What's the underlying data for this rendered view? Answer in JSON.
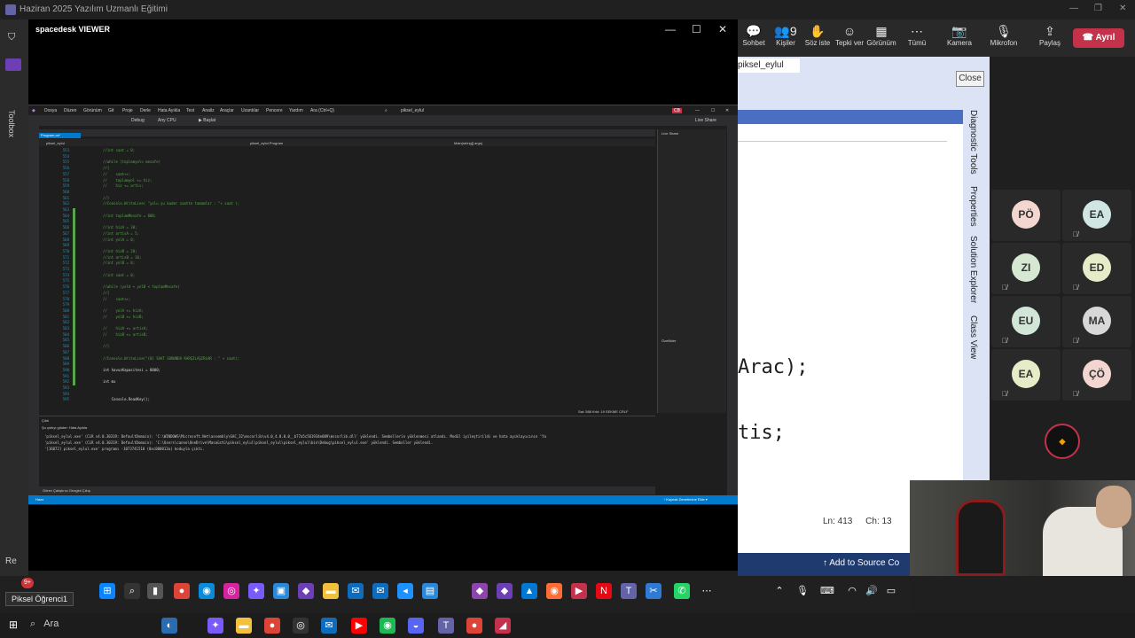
{
  "teams": {
    "window_title": "Haziran 2025 Yazılım Uzmanlı Eğitimi",
    "toolbar": [
      {
        "icon": "chat-icon",
        "label": "Sohbet",
        "glyph": "💬"
      },
      {
        "icon": "people-icon",
        "label": "Kişiler",
        "glyph": "👥",
        "badge": "9"
      },
      {
        "icon": "raise-hand-icon",
        "label": "Söz iste",
        "glyph": "✋"
      },
      {
        "icon": "reaction-icon",
        "label": "Tepki ver",
        "glyph": "☺"
      },
      {
        "icon": "view-icon",
        "label": "Görünüm",
        "glyph": "▦"
      },
      {
        "icon": "more-icon",
        "label": "Tümü",
        "glyph": "⋯"
      },
      {
        "icon": "camera-off-icon",
        "label": "Kamera",
        "glyph": "📷"
      },
      {
        "icon": "mic-off-icon",
        "label": "Mikrofon",
        "glyph": "🎙"
      },
      {
        "icon": "share-icon",
        "label": "Paylaş",
        "glyph": "⇪"
      }
    ],
    "leave_label": "Ayrıl",
    "close_tooltip": "Close"
  },
  "spacedesk": {
    "title": "spacedesk VIEWER"
  },
  "vs_inner": {
    "menu": [
      "Dosya",
      "Düzen",
      "Görünüm",
      "Git",
      "Proje",
      "Derle",
      "Hata Ayıkla",
      "Test",
      "Analiz",
      "Araçlar",
      "Uzantılar",
      "Pencere",
      "Yardım",
      "Ara (Ctrl+Q)"
    ],
    "solution": "piksel_eylul",
    "toolbar_debug": "Debug",
    "toolbar_cpu": "Any CPU",
    "toolbar_start": "▶ Başlat",
    "live_share": "Live Share",
    "tab": "Program.cs*",
    "nav_project": "piksel_eylul",
    "nav_class": "piksel_eylul.Program",
    "nav_method": "Main(string[] args)",
    "code_lines": [
      {
        "n": "553",
        "t": "//int saat = 0;"
      },
      {
        "n": "554",
        "t": ""
      },
      {
        "n": "555",
        "t": "//while (toplamyol< mesafe)"
      },
      {
        "n": "556",
        "t": "//{"
      },
      {
        "n": "557",
        "t": "//    saat++;"
      },
      {
        "n": "558",
        "t": "//    toplamyol += hiz;"
      },
      {
        "n": "559",
        "t": "//    hiz += artis;"
      },
      {
        "n": "560",
        "t": ""
      },
      {
        "n": "561",
        "t": "//}"
      },
      {
        "n": "562",
        "t": "//Console.WriteLine( \"yolu şu kader saatte tamamlar : \"+ saat );"
      },
      {
        "n": "563",
        "t": ""
      },
      {
        "n": "564",
        "t": "//int toplamMesafe = 600;"
      },
      {
        "n": "565",
        "t": ""
      },
      {
        "n": "566",
        "t": "//int hizA = 30;"
      },
      {
        "n": "567",
        "t": "//int artisA = 5;"
      },
      {
        "n": "568",
        "t": "//int yolA = 0;"
      },
      {
        "n": "569",
        "t": ""
      },
      {
        "n": "570",
        "t": "//int hizB = 20;"
      },
      {
        "n": "571",
        "t": "//int artisB = 10;"
      },
      {
        "n": "572",
        "t": "//int yolB = 0;"
      },
      {
        "n": "573",
        "t": ""
      },
      {
        "n": "574",
        "t": "//int saat = 0;"
      },
      {
        "n": "575",
        "t": ""
      },
      {
        "n": "576",
        "t": "//while (yolA + yolB < toplamMesafe)"
      },
      {
        "n": "577",
        "t": "//{"
      },
      {
        "n": "578",
        "t": "//    saat++;"
      },
      {
        "n": "579",
        "t": ""
      },
      {
        "n": "580",
        "t": "//    yolA += hizA;"
      },
      {
        "n": "581",
        "t": "//    yolB += hizB;"
      },
      {
        "n": "582",
        "t": ""
      },
      {
        "n": "583",
        "t": "//    hizA += artisA;"
      },
      {
        "n": "584",
        "t": "//    hizB += artisB;"
      },
      {
        "n": "585",
        "t": ""
      },
      {
        "n": "586",
        "t": "//}"
      },
      {
        "n": "587",
        "t": ""
      },
      {
        "n": "588",
        "t": "//Console.WriteLine(\"{0} SAAT SONUNDA KARŞILAŞIRLAR : \" + saat);"
      },
      {
        "n": "589",
        "t": ""
      },
      {
        "n": "590",
        "t": "int havuzKapasitesi = 8000;"
      },
      {
        "n": "591",
        "t": ""
      },
      {
        "n": "592",
        "t": "int mu"
      },
      {
        "n": "593",
        "t": ""
      },
      {
        "n": "594",
        "t": ""
      },
      {
        "n": "595",
        "t": "    Console.ReadKey();"
      }
    ],
    "position": "Sat: 588   Krkt: 19   SEKME   CRLF",
    "output_title": "Çıktı",
    "output_from": "Şu çıktıyı göster:  Hata Ayıkla",
    "output_lines": [
      "'piksel_eylul.exe' (CLR v4.0.30319: DefaultDomain): 'C:\\WINDOWS\\Microsoft.Net\\assembly\\GAC_32\\mscorlib\\v4.0_4.0.0.0__b77a5c561934e089\\mscorlib.dll' yüklendi. Sembollerin yüklenmesi atlandı. Modül iyileştirildi ve hata ayıklayıcının 'Ya",
      "'piksel_eylul.exe' (CLR v4.0.30319: DefaultDomain): 'C:\\Users\\canno\\OneDrive\\Masaüstü\\piksel_eylul\\piksel_eylul\\piksel_eylul\\bin\\Debug\\piksel_eylul.exe' yüklendi. Semboller yüklendi.",
      "'[16072] piksel_eylul.exe' programı -1073741510 (0xc000013a) koduyla çıktı."
    ],
    "bottom_tab": "Görev Çalıştırıcı Gezgini   Çıkış",
    "status": "Hazır",
    "status_right": "↑ Kaynak Denetimine Ekle ▾",
    "right_panel_title": "Live Share",
    "props_title": "Özellikler"
  },
  "vs_bg": {
    "tab": "piksel_eylul",
    "code1": "Arac);",
    "code2": "tis;",
    "line": "Ln: 413",
    "col": "Ch: 13",
    "vertical_tabs": [
      "Diagnostic Tools",
      "Properties",
      "Solution Explorer",
      "Class View"
    ],
    "toolbox": "Toolbox",
    "add_source": "↑ Add to Source Co"
  },
  "participants": [
    {
      "initials": "PÖ",
      "color": "#f3d6d0",
      "muted": false
    },
    {
      "initials": "EA",
      "color": "#cfe6e3",
      "muted": true
    },
    {
      "initials": "ZI",
      "color": "#d6e8d2",
      "muted": true
    },
    {
      "initials": "ED",
      "color": "#e6ecc8",
      "muted": true
    },
    {
      "initials": "EU",
      "color": "#d2e6d8",
      "muted": true
    },
    {
      "initials": "MA",
      "color": "#d8d8d8",
      "muted": true
    },
    {
      "initials": "EA",
      "color": "#e6ecc8",
      "muted": true
    },
    {
      "initials": "ÇÖ",
      "color": "#f3d6d0",
      "muted": true
    }
  ],
  "taskbar": {
    "tooltip": "Piksel Öğrenci1",
    "badge": "9+",
    "search": "Ara"
  }
}
